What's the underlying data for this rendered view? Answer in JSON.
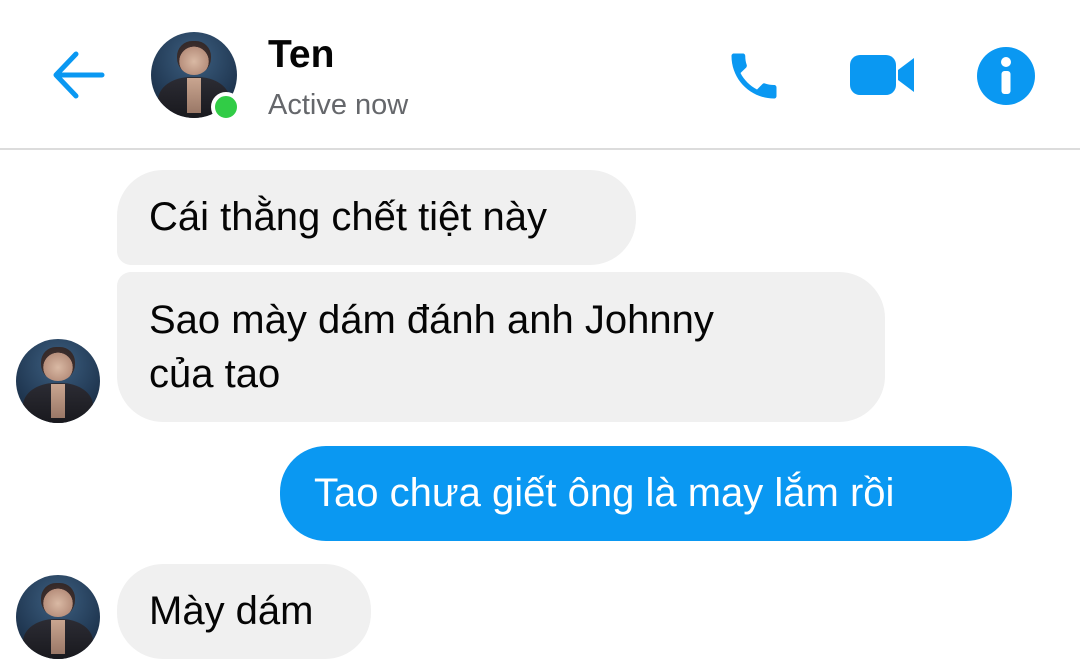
{
  "header": {
    "contact_name": "Ten",
    "status": "Active now",
    "accent_color": "#0a98f2",
    "online_color": "#31cc46",
    "icons": [
      "back-arrow-icon",
      "phone-icon",
      "video-camera-icon",
      "info-icon"
    ]
  },
  "messages": [
    {
      "direction": "incoming",
      "text": "Cái thằng chết tiệt này"
    },
    {
      "direction": "incoming",
      "lines": [
        "Sao mày dám đánh anh Johnny",
        "của tao"
      ]
    },
    {
      "direction": "outgoing",
      "text": "Tao chưa giết ông là may lắm rồi"
    },
    {
      "direction": "incoming",
      "text": "Mày dám"
    }
  ]
}
